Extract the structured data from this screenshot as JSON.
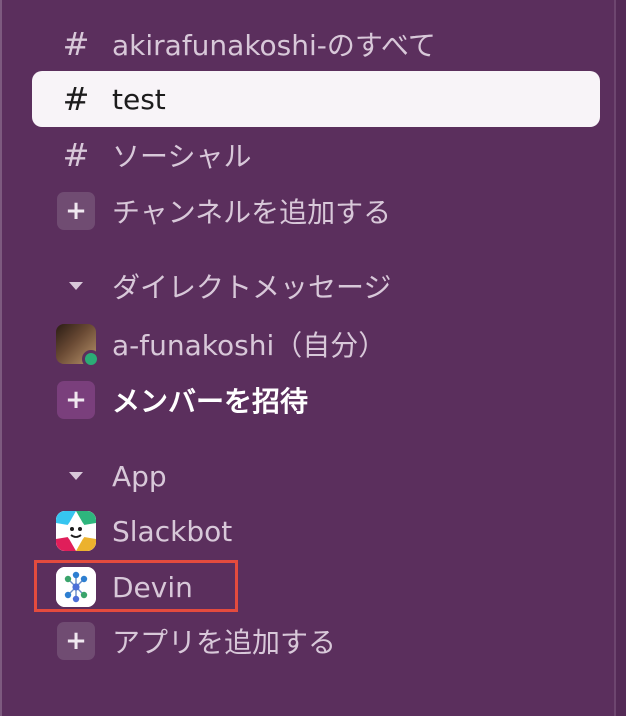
{
  "channels": [
    {
      "label": "akirafunakoshi-のすべて",
      "icon": "hash-icon"
    },
    {
      "label": "test",
      "icon": "hash-icon",
      "active": true
    },
    {
      "label": "ソーシャル",
      "icon": "hash-icon"
    }
  ],
  "add_channel": {
    "label": "チャンネルを追加する",
    "icon": "plus-icon"
  },
  "direct_messages": {
    "section_label": "ダイレクトメッセージ",
    "self": {
      "label": "a-funakoshi（自分）",
      "presence": "online"
    }
  },
  "invite": {
    "label": "メンバーを招待",
    "icon": "plus-icon"
  },
  "apps": {
    "section_label": "App",
    "items": [
      {
        "label": "Slackbot",
        "icon": "slackbot-icon"
      },
      {
        "label": "Devin",
        "icon": "devin-icon"
      }
    ]
  },
  "add_app": {
    "label": "アプリを追加する",
    "icon": "plus-icon"
  },
  "colors": {
    "sidebar_bg": "#5b2f5d",
    "active_bg": "#f8f4f8",
    "text": "#d8c8d9",
    "highlight": "#e44b3e",
    "presence": "#2bac76"
  }
}
